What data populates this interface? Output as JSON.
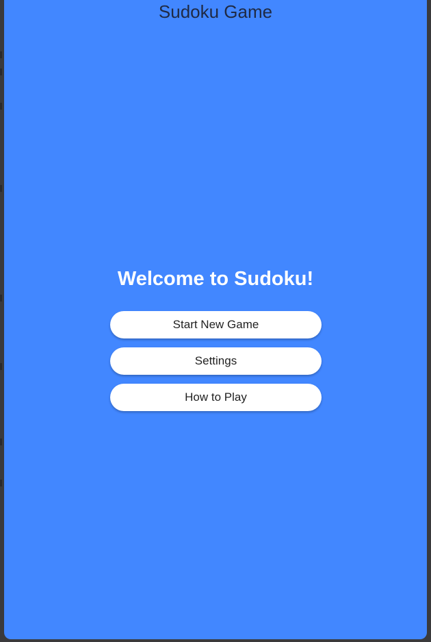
{
  "header": {
    "title": "Sudoku Game"
  },
  "main": {
    "welcome_text": "Welcome to Sudoku!",
    "buttons": [
      {
        "label": "Start New Game"
      },
      {
        "label": "Settings"
      },
      {
        "label": "How to Play"
      }
    ]
  },
  "colors": {
    "background": "#4287ff",
    "button_background": "#ffffff",
    "title_text": "#1f2a44",
    "welcome_text": "#ffffff",
    "button_text": "#222222"
  }
}
